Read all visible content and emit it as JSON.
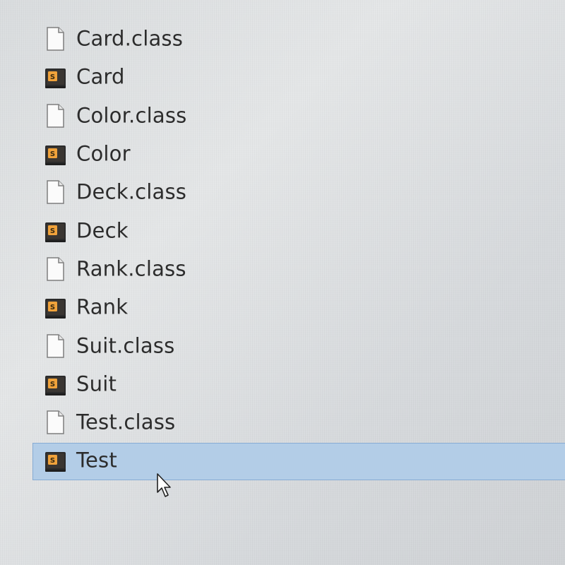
{
  "file_browser": {
    "files": [
      {
        "name": "Card.class",
        "icon": "blank-document-icon",
        "selected": false
      },
      {
        "name": "Card",
        "icon": "sublime-source-file-icon",
        "selected": false
      },
      {
        "name": "Color.class",
        "icon": "blank-document-icon",
        "selected": false
      },
      {
        "name": "Color",
        "icon": "sublime-source-file-icon",
        "selected": false
      },
      {
        "name": "Deck.class",
        "icon": "blank-document-icon",
        "selected": false
      },
      {
        "name": "Deck",
        "icon": "sublime-source-file-icon",
        "selected": false
      },
      {
        "name": "Rank.class",
        "icon": "blank-document-icon",
        "selected": false
      },
      {
        "name": "Rank",
        "icon": "sublime-source-file-icon",
        "selected": false
      },
      {
        "name": "Suit.class",
        "icon": "blank-document-icon",
        "selected": false
      },
      {
        "name": "Suit",
        "icon": "sublime-source-file-icon",
        "selected": false
      },
      {
        "name": "Test.class",
        "icon": "blank-document-icon",
        "selected": false
      },
      {
        "name": "Test",
        "icon": "sublime-source-file-icon",
        "selected": true
      }
    ]
  },
  "colors": {
    "selection_background": "#b3cde7",
    "selection_border": "#87acd4",
    "text": "#2c2c2c"
  }
}
